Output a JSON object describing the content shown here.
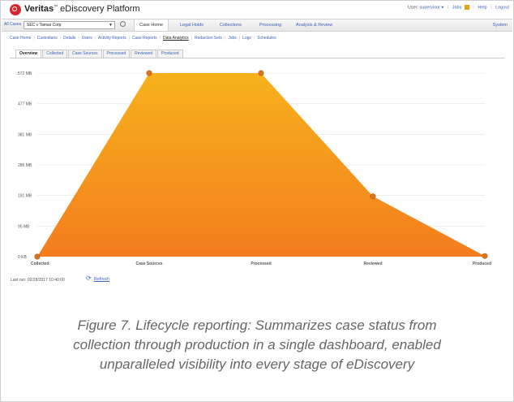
{
  "header": {
    "brand_bold": "Veritas",
    "brand_tm": "™",
    "brand_rest": " eDiscovery Platform",
    "user_label": "User:",
    "user_name": "supervisor ▾",
    "jobs_label": "Jobs",
    "help_label": "Help",
    "logout_label": "Logout"
  },
  "casebar": {
    "all_cases_label": "All Cases",
    "case_select_value": "SEC v Tamas Corp",
    "nav": [
      "Case Home",
      "Legal Holds",
      "Collections",
      "Processing",
      "Analysis & Review"
    ],
    "active_nav": "Case Home",
    "system_label": "System"
  },
  "subnav": {
    "items": [
      "Case Home",
      "Custodians",
      "Details",
      "Users",
      "Activity Reports",
      "Case Reports",
      "Data Analytics",
      "Redaction Sets",
      "Jobs",
      "Logs",
      "Schedules"
    ],
    "active": "Data Analytics"
  },
  "tabs": {
    "items": [
      "Overview",
      "Collected",
      "Case Sources",
      "Processed",
      "Reviewed",
      "Produced"
    ],
    "active": "Overview"
  },
  "chart_data": {
    "type": "area",
    "categories": [
      "Collected",
      "Case Sources",
      "Processed",
      "Reviewed",
      "Produced"
    ],
    "values": [
      0,
      572,
      572,
      188,
      2
    ],
    "y_tick_labels": [
      "572 MB",
      "477 MB",
      "381 MB",
      "286 MB",
      "191 MB",
      "95 MB",
      "0 KB"
    ],
    "ylim": [
      0,
      572
    ],
    "yunit": "MB",
    "grid": true,
    "colors": {
      "fill_top": "#f6b21c",
      "fill_bottom": "#f47d1f",
      "marker": "#d9761e",
      "marker_stroke": "#b25a12"
    }
  },
  "footer": {
    "last_run": "Last run: 02/28/2017 10:40:00",
    "refresh_label": "Refresh"
  },
  "caption": {
    "line1": "Figure 7. Lifecycle reporting: Summarizes case status from",
    "line2": "collection through production in a single dashboard, enabled",
    "line3": "unparalleled visibility into every stage of eDiscovery"
  }
}
